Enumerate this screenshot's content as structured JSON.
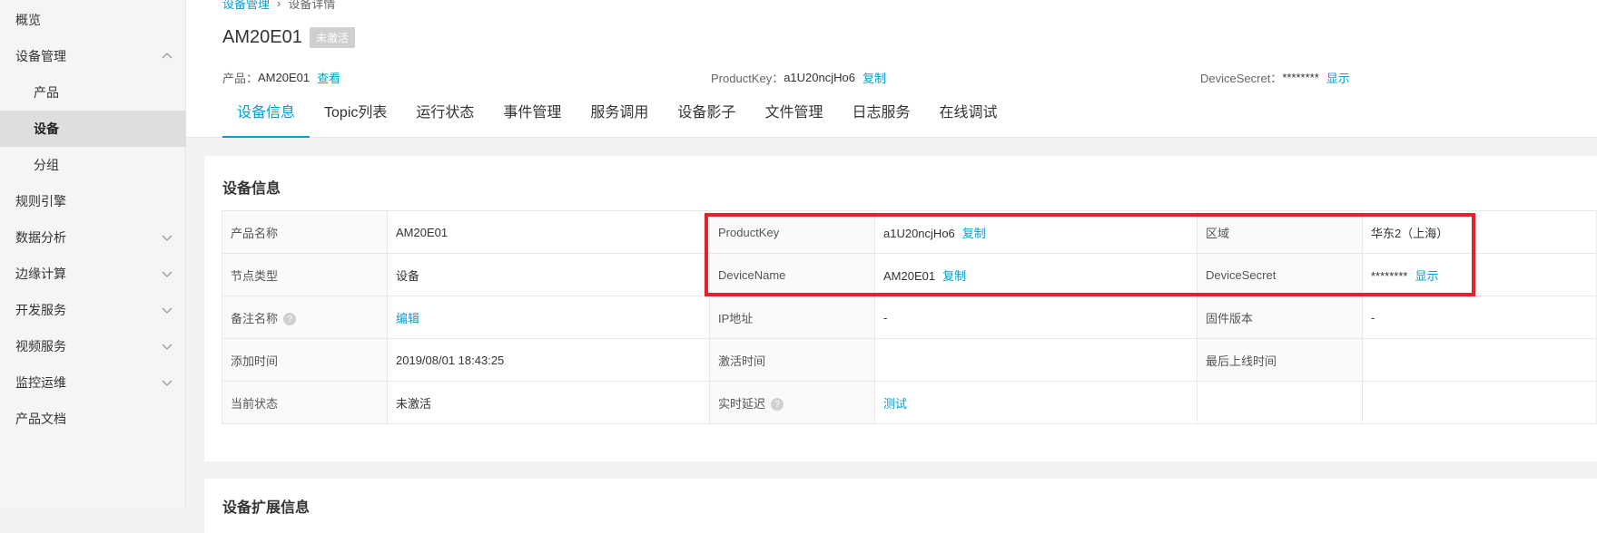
{
  "sidebar": {
    "items": [
      {
        "label": "概览"
      },
      {
        "label": "设备管理"
      },
      {
        "label": "产品"
      },
      {
        "label": "设备"
      },
      {
        "label": "分组"
      },
      {
        "label": "规则引擎"
      },
      {
        "label": "数据分析"
      },
      {
        "label": "边缘计算"
      },
      {
        "label": "开发服务"
      },
      {
        "label": "视频服务"
      },
      {
        "label": "监控运维"
      },
      {
        "label": "产品文档"
      }
    ]
  },
  "breadcrumb": {
    "parent": "设备管理",
    "separator": "›",
    "current": "设备详情"
  },
  "header": {
    "title": "AM20E01",
    "status": "未激活",
    "product_label": "产品：",
    "product_value": "AM20E01",
    "product_link": "查看",
    "productkey_label": "ProductKey：",
    "productkey_value": "a1U20ncjHo6",
    "productkey_link": "复制",
    "devicesecret_label": "DeviceSecret：",
    "devicesecret_value": "********",
    "devicesecret_link": "显示"
  },
  "tabs": [
    {
      "label": "设备信息"
    },
    {
      "label": "Topic列表"
    },
    {
      "label": "运行状态"
    },
    {
      "label": "事件管理"
    },
    {
      "label": "服务调用"
    },
    {
      "label": "设备影子"
    },
    {
      "label": "文件管理"
    },
    {
      "label": "日志服务"
    },
    {
      "label": "在线调试"
    }
  ],
  "device_info": {
    "title": "设备信息",
    "rows": [
      {
        "l1": "产品名称",
        "v1": "AM20E01",
        "l2": "ProductKey",
        "v2": "a1U20ncjHo6",
        "v2_link": "复制",
        "l3": "区域",
        "v3": "华东2（上海）"
      },
      {
        "l1": "节点类型",
        "v1": "设备",
        "l2": "DeviceName",
        "v2": "AM20E01",
        "v2_link": "复制",
        "l3": "DeviceSecret",
        "v3": "********",
        "v3_link": "显示"
      },
      {
        "l1": "备注名称",
        "v1_link": "编辑",
        "l2": "IP地址",
        "v2": "-",
        "l3": "固件版本",
        "v3": "-"
      },
      {
        "l1": "添加时间",
        "v1": "2019/08/01 18:43:25",
        "l2": "激活时间",
        "v2": "",
        "l3": "最后上线时间",
        "v3": ""
      },
      {
        "l1": "当前状态",
        "v1": "未激活",
        "l2": "实时延迟",
        "v2_link": "测试",
        "l3": "",
        "v3": ""
      }
    ]
  },
  "extended_info": {
    "title": "设备扩展信息"
  },
  "colors": {
    "accent": "#00a0d2",
    "highlight": "#e2232e"
  }
}
